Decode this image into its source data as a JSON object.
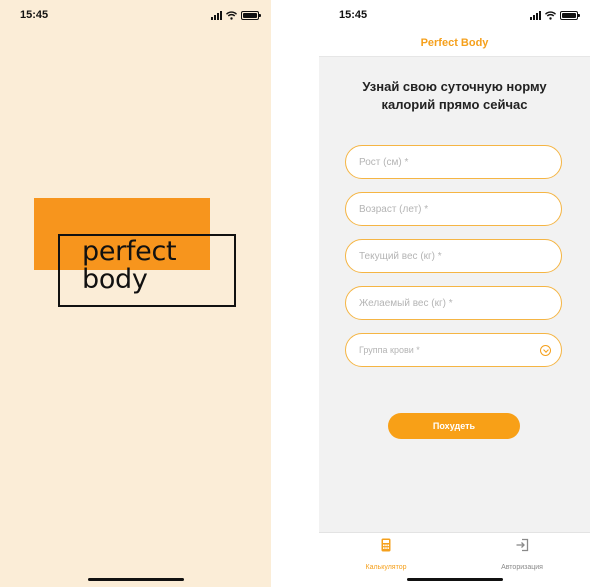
{
  "splash": {
    "status_time": "15:45",
    "logo_line1": "perfect",
    "logo_line2": "body"
  },
  "app": {
    "status_time": "15:45",
    "nav_title": "Perfect Body",
    "headline_line1": "Узнай свою суточную норму",
    "headline_line2": "калорий прямо сейчас",
    "fields": {
      "height_placeholder": "Рост (см) *",
      "age_placeholder": "Возраст (лет) *",
      "weight_placeholder": "Текущий вес (кг) *",
      "target_placeholder": "Желаемый вес (кг) *",
      "blood_placeholder": "Группа крови *"
    },
    "cta_label": "Похудеть",
    "tabs": {
      "calculator": {
        "label": "Калькулятор",
        "icon": "calculator-icon",
        "active": true
      },
      "auth": {
        "label": "Авторизация",
        "icon": "login-icon",
        "active": false
      }
    }
  },
  "colors": {
    "accent": "#f7951d",
    "splash_background": "#fbedd7",
    "app_background": "#f2f2f2",
    "field_border": "#f5b544"
  }
}
